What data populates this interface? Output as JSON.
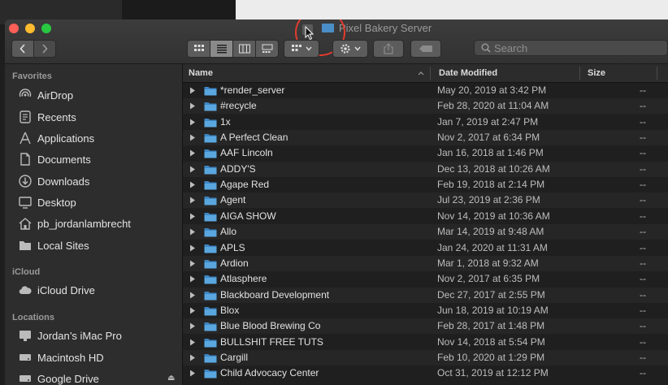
{
  "window": {
    "title": "Pixel Bakery Server"
  },
  "toolbar": {
    "search_placeholder": "Search"
  },
  "sidebar": {
    "favorites_label": "Favorites",
    "favorites": [
      {
        "label": "AirDrop",
        "icon": "airdrop-icon"
      },
      {
        "label": "Recents",
        "icon": "recents-icon"
      },
      {
        "label": "Applications",
        "icon": "applications-icon"
      },
      {
        "label": "Documents",
        "icon": "documents-icon"
      },
      {
        "label": "Downloads",
        "icon": "downloads-icon"
      },
      {
        "label": "Desktop",
        "icon": "desktop-icon"
      },
      {
        "label": "pb_jordanlambrecht",
        "icon": "home-icon"
      },
      {
        "label": "Local Sites",
        "icon": "folder-icon"
      }
    ],
    "icloud_label": "iCloud",
    "icloud": [
      {
        "label": "iCloud Drive",
        "icon": "cloud-icon"
      }
    ],
    "locations_label": "Locations",
    "locations": [
      {
        "label": "Jordan’s iMac Pro",
        "icon": "imac-icon"
      },
      {
        "label": "Macintosh HD",
        "icon": "disk-icon"
      },
      {
        "label": "Google Drive",
        "icon": "disk-icon"
      }
    ]
  },
  "columns": {
    "name": "Name",
    "date": "Date Modified",
    "size": "Size"
  },
  "rows": [
    {
      "name": "*render_server",
      "date": "May 20, 2019 at 3:42 PM",
      "size": "--"
    },
    {
      "name": "#recycle",
      "date": "Feb 28, 2020 at 11:04 AM",
      "size": "--"
    },
    {
      "name": "1x",
      "date": "Jan 7, 2019 at 2:47 PM",
      "size": "--"
    },
    {
      "name": "A Perfect Clean",
      "date": "Nov 2, 2017 at 6:34 PM",
      "size": "--"
    },
    {
      "name": "AAF Lincoln",
      "date": "Jan 16, 2018 at 1:46 PM",
      "size": "--"
    },
    {
      "name": "ADDY'S",
      "date": "Dec 13, 2018 at 10:26 AM",
      "size": "--"
    },
    {
      "name": "Agape Red",
      "date": "Feb 19, 2018 at 2:14 PM",
      "size": "--"
    },
    {
      "name": "Agent",
      "date": "Jul 23, 2019 at 2:36 PM",
      "size": "--"
    },
    {
      "name": "AIGA SHOW",
      "date": "Nov 14, 2019 at 10:36 AM",
      "size": "--"
    },
    {
      "name": "Allo",
      "date": "Mar 14, 2019 at 9:48 AM",
      "size": "--"
    },
    {
      "name": "APLS",
      "date": "Jan 24, 2020 at 11:31 AM",
      "size": "--"
    },
    {
      "name": "Ardion",
      "date": "Mar 1, 2018 at 9:32 AM",
      "size": "--"
    },
    {
      "name": "Atlasphere",
      "date": "Nov 2, 2017 at 6:35 PM",
      "size": "--"
    },
    {
      "name": "Blackboard Development",
      "date": "Dec 27, 2017 at 2:55 PM",
      "size": "--"
    },
    {
      "name": "Blox",
      "date": "Jun 18, 2019 at 10:19 AM",
      "size": "--"
    },
    {
      "name": "Blue Blood Brewing Co",
      "date": "Feb 28, 2017 at 1:48 PM",
      "size": "--"
    },
    {
      "name": "BULLSHIT FREE TUTS",
      "date": "Nov 14, 2018 at 5:54 PM",
      "size": "--"
    },
    {
      "name": "Cargill",
      "date": "Feb 10, 2020 at 1:29 PM",
      "size": "--"
    },
    {
      "name": "Child Advocacy Center",
      "date": "Oct 31, 2019 at 12:12 PM",
      "size": "--"
    }
  ],
  "colors": {
    "accent": "#4a8ec7",
    "highlight": "#e23b2e"
  }
}
